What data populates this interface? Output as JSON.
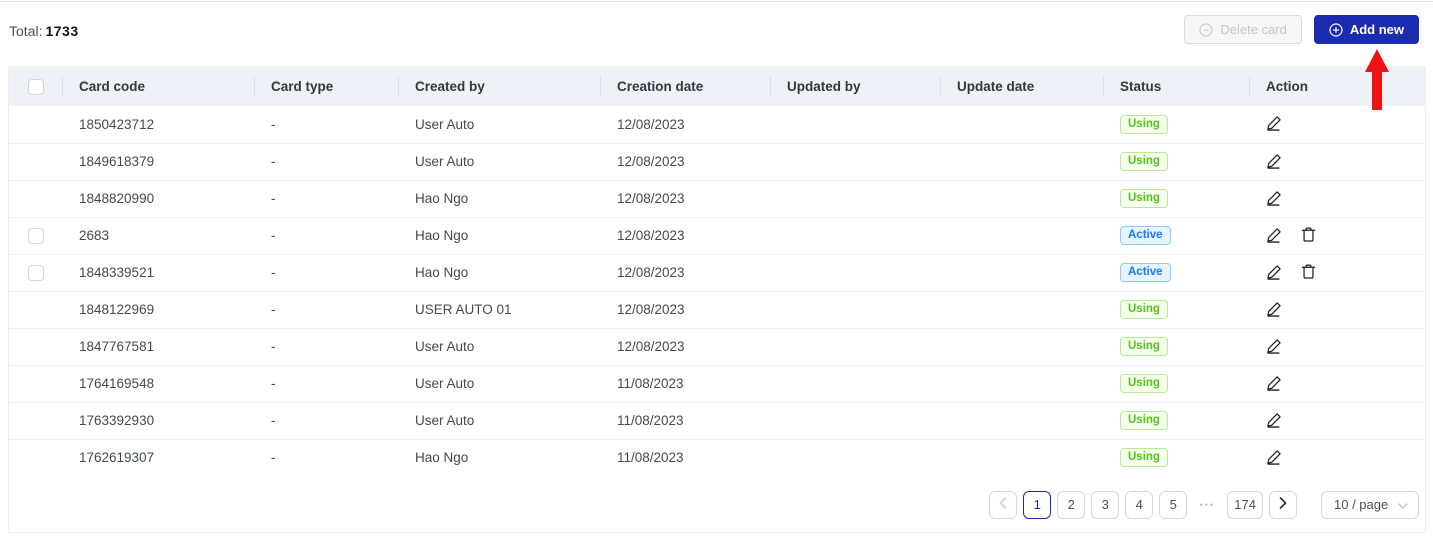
{
  "toolbar": {
    "total_label": "Total:",
    "total_value": "1733",
    "delete_button_label": "Delete card",
    "add_button_label": "Add new"
  },
  "table": {
    "columns": [
      "Card code",
      "Card type",
      "Created by",
      "Creation date",
      "Updated by",
      "Update date",
      "Status",
      "Action"
    ],
    "rows": [
      {
        "checkbox": false,
        "card_code": "1850423712",
        "card_type": "-",
        "created_by": "User Auto",
        "creation_date": "12/08/2023",
        "updated_by": "",
        "update_date": "",
        "status": "Using",
        "actions": [
          "edit"
        ]
      },
      {
        "checkbox": false,
        "card_code": "1849618379",
        "card_type": "-",
        "created_by": "User Auto",
        "creation_date": "12/08/2023",
        "updated_by": "",
        "update_date": "",
        "status": "Using",
        "actions": [
          "edit"
        ]
      },
      {
        "checkbox": false,
        "card_code": "1848820990",
        "card_type": "-",
        "created_by": "Hao Ngo",
        "creation_date": "12/08/2023",
        "updated_by": "",
        "update_date": "",
        "status": "Using",
        "actions": [
          "edit"
        ]
      },
      {
        "checkbox": true,
        "card_code": "2683",
        "card_type": "-",
        "created_by": "Hao Ngo",
        "creation_date": "12/08/2023",
        "updated_by": "",
        "update_date": "",
        "status": "Active",
        "actions": [
          "edit",
          "delete"
        ]
      },
      {
        "checkbox": true,
        "card_code": "1848339521",
        "card_type": "-",
        "created_by": "Hao Ngo",
        "creation_date": "12/08/2023",
        "updated_by": "",
        "update_date": "",
        "status": "Active",
        "actions": [
          "edit",
          "delete"
        ]
      },
      {
        "checkbox": false,
        "card_code": "1848122969",
        "card_type": "-",
        "created_by": "USER AUTO 01",
        "creation_date": "12/08/2023",
        "updated_by": "",
        "update_date": "",
        "status": "Using",
        "actions": [
          "edit"
        ]
      },
      {
        "checkbox": false,
        "card_code": "1847767581",
        "card_type": "-",
        "created_by": "User Auto",
        "creation_date": "12/08/2023",
        "updated_by": "",
        "update_date": "",
        "status": "Using",
        "actions": [
          "edit"
        ]
      },
      {
        "checkbox": false,
        "card_code": "1764169548",
        "card_type": "-",
        "created_by": "User Auto",
        "creation_date": "11/08/2023",
        "updated_by": "",
        "update_date": "",
        "status": "Using",
        "actions": [
          "edit"
        ]
      },
      {
        "checkbox": false,
        "card_code": "1763392930",
        "card_type": "-",
        "created_by": "User Auto",
        "creation_date": "11/08/2023",
        "updated_by": "",
        "update_date": "",
        "status": "Using",
        "actions": [
          "edit"
        ]
      },
      {
        "checkbox": false,
        "card_code": "1762619307",
        "card_type": "-",
        "created_by": "Hao Ngo",
        "creation_date": "11/08/2023",
        "updated_by": "",
        "update_date": "",
        "status": "Using",
        "actions": [
          "edit"
        ]
      }
    ],
    "status_styles": {
      "Using": {
        "text": "#52c41a",
        "bg": "#f6ffed",
        "border": "#b7eb8f"
      },
      "Active": {
        "text": "#1677ff",
        "bg": "#e6f4ff",
        "border": "#91caff"
      }
    }
  },
  "pagination": {
    "pages": [
      "1",
      "2",
      "3",
      "4",
      "5",
      "•••",
      "174"
    ],
    "active_page": "1",
    "ellipsis": "•••",
    "page_size": "10 / page"
  },
  "colors": {
    "primary": "#1c2cb0",
    "arrow_red": "#ee1212",
    "header_bg": "#eef1f6"
  }
}
